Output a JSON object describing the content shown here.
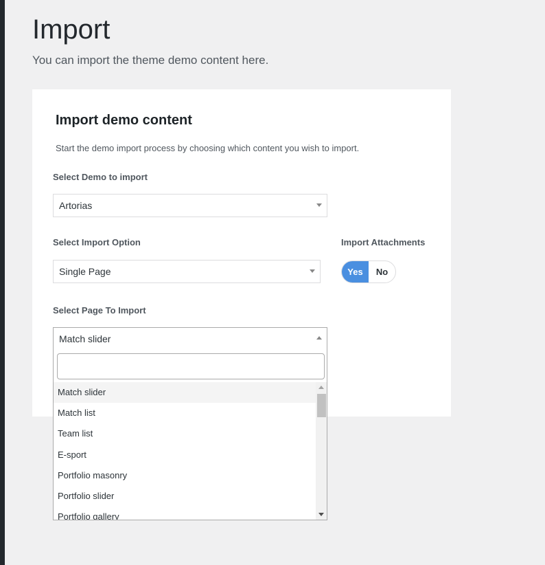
{
  "page": {
    "title": "Import",
    "subtitle": "You can import the theme demo content here."
  },
  "card": {
    "title": "Import demo content",
    "description": "Start the demo import process by choosing which content you wish to import."
  },
  "demo_select": {
    "label": "Select Demo to import",
    "value": "Artorias"
  },
  "import_option": {
    "label": "Select Import Option",
    "value": "Single Page"
  },
  "attachments": {
    "label": "Import Attachments",
    "yes_label": "Yes",
    "no_label": "No",
    "selected": "Yes",
    "active_color": "#4a8fe0"
  },
  "page_select": {
    "label": "Select Page To Import",
    "value": "Match slider",
    "search_value": "",
    "options": [
      "Match slider",
      "Match list",
      "Team list",
      "E-sport",
      "Portfolio masonry",
      "Portfolio slider",
      "Portfolio gallery"
    ],
    "highlighted_index": 0
  },
  "icons": {
    "select_arrow": "chevron-down-icon",
    "open_arrow": "chevron-up-icon",
    "scroll_up": "scroll-up-arrow-icon",
    "scroll_down": "scroll-down-arrow-icon"
  }
}
